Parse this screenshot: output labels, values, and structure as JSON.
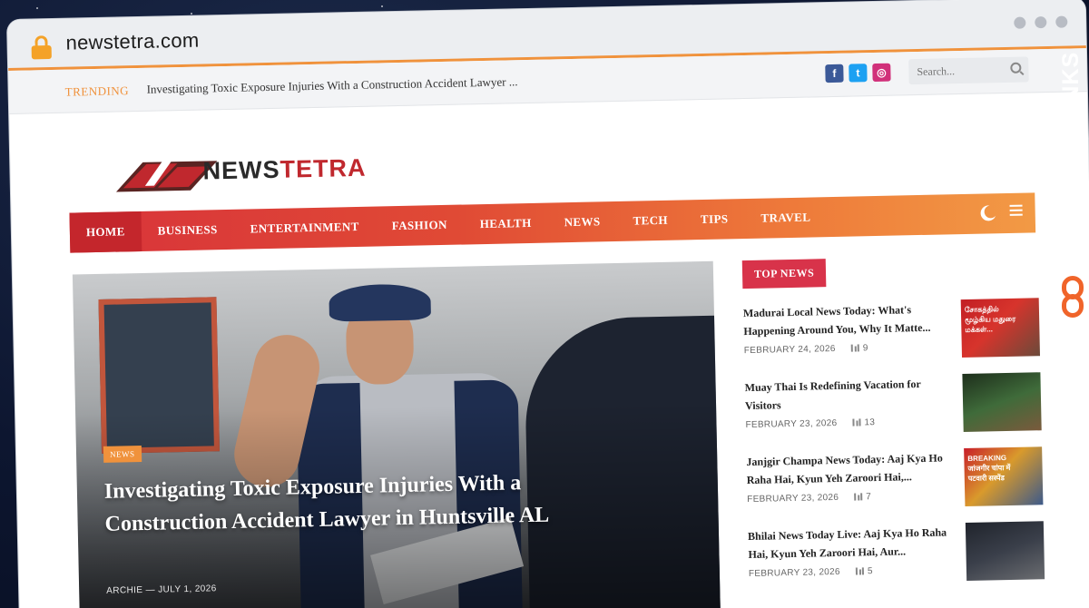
{
  "browser": {
    "url": "newstetra.com"
  },
  "topbar": {
    "trending_label": "TRENDING",
    "trending_text": "Investigating Toxic Exposure Injuries With a Construction Accident Lawyer ...",
    "search_placeholder": "Search..."
  },
  "logo": {
    "part1": "NEWS",
    "part2": "TETRA"
  },
  "nav": {
    "items": [
      "HOME",
      "BUSINESS",
      "ENTERTAINMENT",
      "FASHION",
      "HEALTH",
      "NEWS",
      "TECH",
      "TIPS",
      "TRAVEL"
    ],
    "active": "HOME"
  },
  "hero": {
    "badge": "NEWS",
    "title": "Investigating Toxic Exposure Injuries With a Construction Accident Lawyer in Huntsville AL",
    "author": "ARCHIE",
    "separator": "—",
    "date": "JULY 1, 2026"
  },
  "top_news": {
    "label": "TOP NEWS",
    "items": [
      {
        "title": "Madurai Local News Today: What's Happening Around You, Why It Matte...",
        "date": "FEBRUARY 24, 2026",
        "views": "9",
        "thumb_text": "சோகத்தில் மூழ்கிய மதுரை மக்கள்..."
      },
      {
        "title": "Muay Thai Is Redefining Vacation for Visitors",
        "date": "FEBRUARY 23, 2026",
        "views": "13",
        "thumb_text": ""
      },
      {
        "title": "Janjgir Champa News Today: Aaj Kya Ho Raha Hai, Kyun Yeh Zaroori Hai,...",
        "date": "FEBRUARY 23, 2026",
        "views": "7",
        "thumb_text": "BREAKING जांजगीर चांपा में पटवारी सस्पेंड"
      },
      {
        "title": "Bhilai News Today Live: Aaj Kya Ho Raha Hai, Kyun Yeh Zaroori Hai, Aur...",
        "date": "FEBRUARY 23, 2026",
        "views": "5",
        "thumb_text": ""
      }
    ]
  },
  "side_brand": {
    "text": "GUESTPOSTLINKS"
  },
  "colors": {
    "accent": "#f0923c",
    "nav_start": "#d8333a",
    "nav_end": "#f29a45",
    "top_news_tag": "#d8334a"
  },
  "icons": [
    "lock-icon",
    "facebook-icon",
    "twitter-icon",
    "instagram-icon",
    "search-icon",
    "moon-icon",
    "menu-icon",
    "views-icon",
    "link-icon"
  ]
}
